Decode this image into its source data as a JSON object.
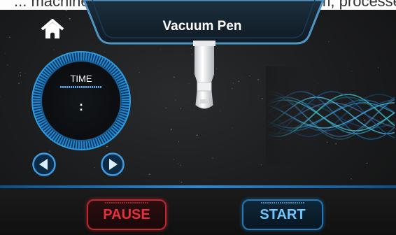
{
  "caption": "... machine (stepping function, vacuum system, processes)",
  "header": {
    "title": "Vacuum Pen"
  },
  "timer": {
    "label": "TIME",
    "value": ":"
  },
  "buttons": {
    "pause": "PAUSE",
    "start": "START"
  },
  "icons": {
    "home": "home-icon",
    "prev": "arrow-left-icon",
    "next": "arrow-right-icon",
    "handpiece": "vacuum-pen-handpiece-icon"
  },
  "colors": {
    "accent_blue": "#2a8ad6",
    "pause_red": "#e8303a",
    "start_blue": "#6ec6ff",
    "background": "#1b1c1e"
  }
}
